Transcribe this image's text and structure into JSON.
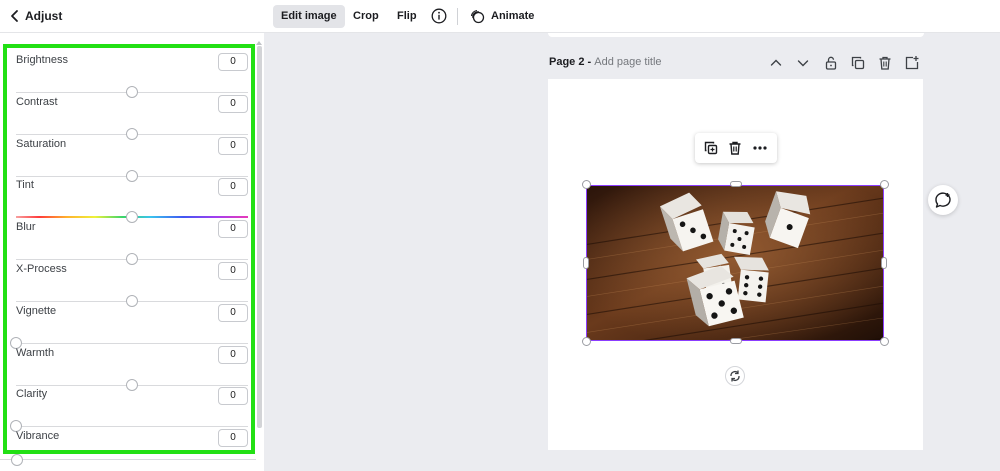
{
  "panel": {
    "title": "Adjust",
    "sliders": [
      {
        "label": "Brightness",
        "value": "0",
        "level": 0.5
      },
      {
        "label": "Contrast",
        "value": "0",
        "level": 0.5
      },
      {
        "label": "Saturation",
        "value": "0",
        "level": 0.5
      },
      {
        "label": "Tint",
        "value": "0",
        "level": 0.5,
        "rainbow": true
      },
      {
        "label": "Blur",
        "value": "0",
        "level": 0.5
      },
      {
        "label": "X-Process",
        "value": "0",
        "level": 0.5
      },
      {
        "label": "Vignette",
        "value": "0",
        "level": 0.0
      },
      {
        "label": "Warmth",
        "value": "0",
        "level": 0.5
      },
      {
        "label": "Clarity",
        "value": "0",
        "level": 0.0
      },
      {
        "label": "Vibrance",
        "value": "0",
        "level": 0.0
      }
    ],
    "highlight_color": "#22e014"
  },
  "toolbar": {
    "edit_image": "Edit image",
    "crop": "Crop",
    "flip": "Flip",
    "animate": "Animate"
  },
  "page": {
    "label": "Page 2",
    "separator": " - ",
    "title_placeholder": "Add page title"
  },
  "icons": {
    "back": "chevron-left-icon",
    "info": "info-icon",
    "animate": "animate-icon",
    "page_actions": [
      "chevron-up-icon",
      "chevron-down-icon",
      "lock-icon",
      "duplicate-icon",
      "trash-icon",
      "add-page-icon"
    ],
    "float_toolbar": [
      "duplicate-icon",
      "trash-icon",
      "more-icon"
    ],
    "rotate": "rotate-icon",
    "comment": "add-comment-icon"
  },
  "selection_color": "#8b3dff"
}
